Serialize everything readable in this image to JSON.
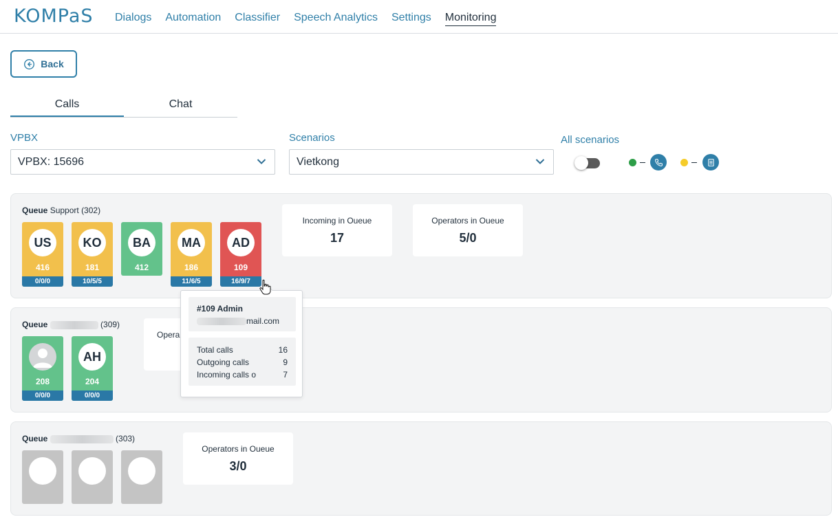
{
  "header": {
    "logo": "KOMPaS",
    "nav": [
      "Dialogs",
      "Automation",
      "Classifier",
      "Speech Analytics",
      "Settings",
      "Monitoring"
    ],
    "active_nav": "Monitoring"
  },
  "back_label": "Back",
  "tabs": [
    "Calls",
    "Chat"
  ],
  "filters": {
    "vpbx_label": "VPBX",
    "vpbx_value": "VPBX: 15696",
    "scenarios_label": "Scenarios",
    "scenarios_value": "Vietkong",
    "all_scenarios_label": "All scenarios",
    "all_scenarios_on": false
  },
  "legend": [
    {
      "color": "#2e9e48",
      "icon": "phone-icon"
    },
    {
      "color": "#f5cc2a",
      "icon": "document-icon"
    }
  ],
  "colors": {
    "accent": "#2f7fa8",
    "busy": "#f2c04c",
    "free": "#63c28b",
    "alert": "#e05554",
    "offline": "#c4c4c4"
  },
  "queues": [
    {
      "label": "Queue",
      "name": "Support",
      "number": "(302)",
      "operators": [
        {
          "initials": "US",
          "ext": "416",
          "stats": "0/0/0",
          "status": "busy"
        },
        {
          "initials": "KO",
          "ext": "181",
          "stats": "10/5/5",
          "status": "busy"
        },
        {
          "initials": "BA",
          "ext": "412",
          "stats": "",
          "status": "free"
        },
        {
          "initials": "MA",
          "ext": "186",
          "stats": "11/6/5",
          "status": "busy"
        },
        {
          "initials": "AD",
          "ext": "109",
          "stats": "16/9/7",
          "status": "alert"
        }
      ],
      "cards": [
        {
          "title": "Incoming in Oueue",
          "value": "17"
        },
        {
          "title": "Operators in Oueue",
          "value": "5/0"
        }
      ]
    },
    {
      "label": "Queue",
      "name": "",
      "number": "(309)",
      "operators": [
        {
          "initials": "",
          "ext": "208",
          "stats": "0/0/0",
          "status": "free",
          "photo": true
        },
        {
          "initials": "AH",
          "ext": "204",
          "stats": "0/0/0",
          "status": "free"
        }
      ],
      "cards": [
        {
          "title": "Opera",
          "value": ""
        }
      ]
    },
    {
      "label": "Queue",
      "name": "",
      "number": "(303)",
      "operators": [
        {
          "initials": "",
          "ext": "",
          "stats": "",
          "status": "offline"
        },
        {
          "initials": "",
          "ext": "",
          "stats": "",
          "status": "offline"
        },
        {
          "initials": "",
          "ext": "",
          "stats": "",
          "status": "offline"
        }
      ],
      "cards": [
        {
          "title": "Operators in Oueue",
          "value": "3/0"
        }
      ]
    }
  ],
  "tooltip": {
    "name": "#109 Admin",
    "email_suffix": "mail.com",
    "rows": [
      {
        "label": "Total calls",
        "value": "16"
      },
      {
        "label": "Outgoing calls",
        "value": "9"
      },
      {
        "label": "Incoming calls o",
        "value": "7"
      }
    ]
  }
}
